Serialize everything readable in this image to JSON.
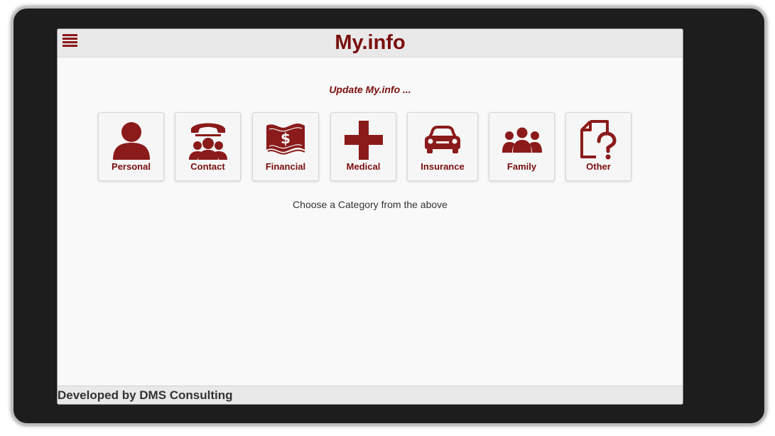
{
  "header": {
    "title": "My.info",
    "menu_icon": "hamburger-menu-icon"
  },
  "main": {
    "subtitle": "Update My.info ...",
    "categories": [
      {
        "label": "Personal",
        "icon": "person-icon"
      },
      {
        "label": "Contact",
        "icon": "phone-contacts-icon"
      },
      {
        "label": "Financial",
        "icon": "money-bill-icon"
      },
      {
        "label": "Medical",
        "icon": "medical-cross-icon"
      },
      {
        "label": "Insurance",
        "icon": "car-icon"
      },
      {
        "label": "Family",
        "icon": "family-icon"
      },
      {
        "label": "Other",
        "icon": "document-question-icon"
      }
    ],
    "hint": "Choose a Category from the above"
  },
  "footer": {
    "text": "Developed by DMS Consulting"
  },
  "colors": {
    "accent": "#7a0e0e",
    "bezel": "#1d1d1d",
    "screen_bg": "#f9f9f9",
    "bar_bg": "#e9e9e9"
  }
}
